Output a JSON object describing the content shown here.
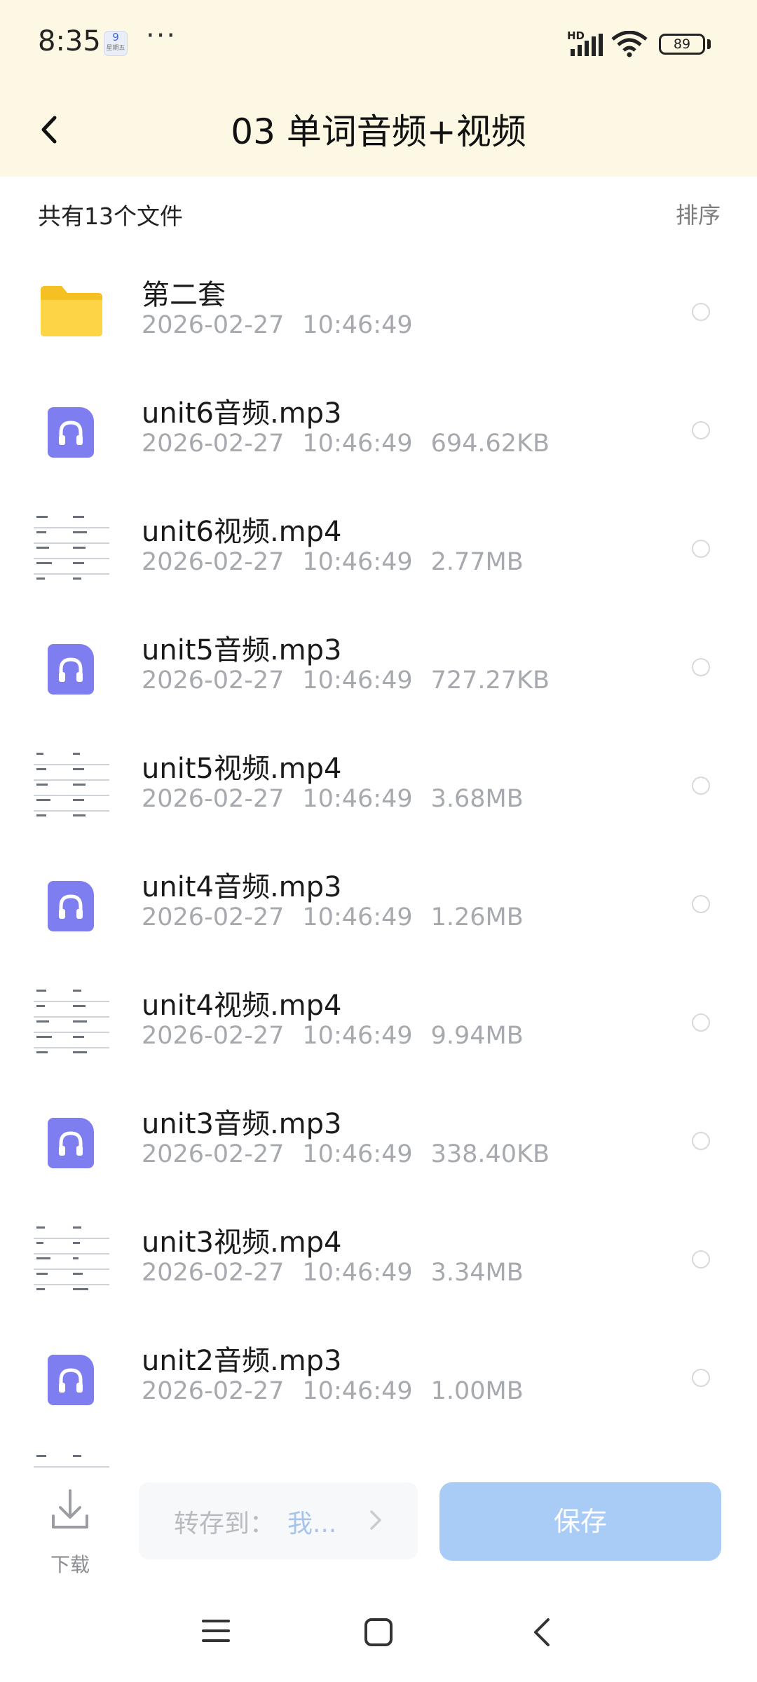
{
  "status_bar": {
    "time": "8:35",
    "calendar_badge": "9",
    "calendar_badge_sub": "星期五",
    "more_dots": "···",
    "network_label": "HD",
    "battery": "89"
  },
  "header": {
    "title": "03 单词音频+视频",
    "background_color": "#fcf8e3"
  },
  "list_header": {
    "count_label": "共有13个文件",
    "sort_label": "排序"
  },
  "files": [
    {
      "name": "第二套",
      "date": "2026-02-27",
      "time": "10:46:49",
      "size": "",
      "type": "folder"
    },
    {
      "name": "unit6音频.mp3",
      "date": "2026-02-27",
      "time": "10:46:49",
      "size": "694.62KB",
      "type": "audio"
    },
    {
      "name": "unit6视频.mp4",
      "date": "2026-02-27",
      "time": "10:46:49",
      "size": "2.77MB",
      "type": "video"
    },
    {
      "name": "unit5音频.mp3",
      "date": "2026-02-27",
      "time": "10:46:49",
      "size": "727.27KB",
      "type": "audio"
    },
    {
      "name": "unit5视频.mp4",
      "date": "2026-02-27",
      "time": "10:46:49",
      "size": "3.68MB",
      "type": "video"
    },
    {
      "name": "unit4音频.mp3",
      "date": "2026-02-27",
      "time": "10:46:49",
      "size": "1.26MB",
      "type": "audio"
    },
    {
      "name": "unit4视频.mp4",
      "date": "2026-02-27",
      "time": "10:46:49",
      "size": "9.94MB",
      "type": "video"
    },
    {
      "name": "unit3音频.mp3",
      "date": "2026-02-27",
      "time": "10:46:49",
      "size": "338.40KB",
      "type": "audio"
    },
    {
      "name": "unit3视频.mp4",
      "date": "2026-02-27",
      "time": "10:46:49",
      "size": "3.34MB",
      "type": "video"
    },
    {
      "name": "unit2音频.mp3",
      "date": "2026-02-27",
      "time": "10:46:49",
      "size": "1.00MB",
      "type": "audio"
    }
  ],
  "action_bar": {
    "download_label": "下载",
    "save_to_prefix": "转存到：",
    "save_to_target": "我...",
    "save_label": "保存",
    "save_color": "#a9ccf7"
  },
  "icons": {
    "folder": "folder-icon",
    "audio": "headphones-icon",
    "video": "video-thumbnail",
    "back": "chevron-left-icon",
    "download": "download-icon",
    "nav_menu": "menu-icon",
    "nav_home": "home-square-icon",
    "nav_back": "back-triangle-icon"
  }
}
